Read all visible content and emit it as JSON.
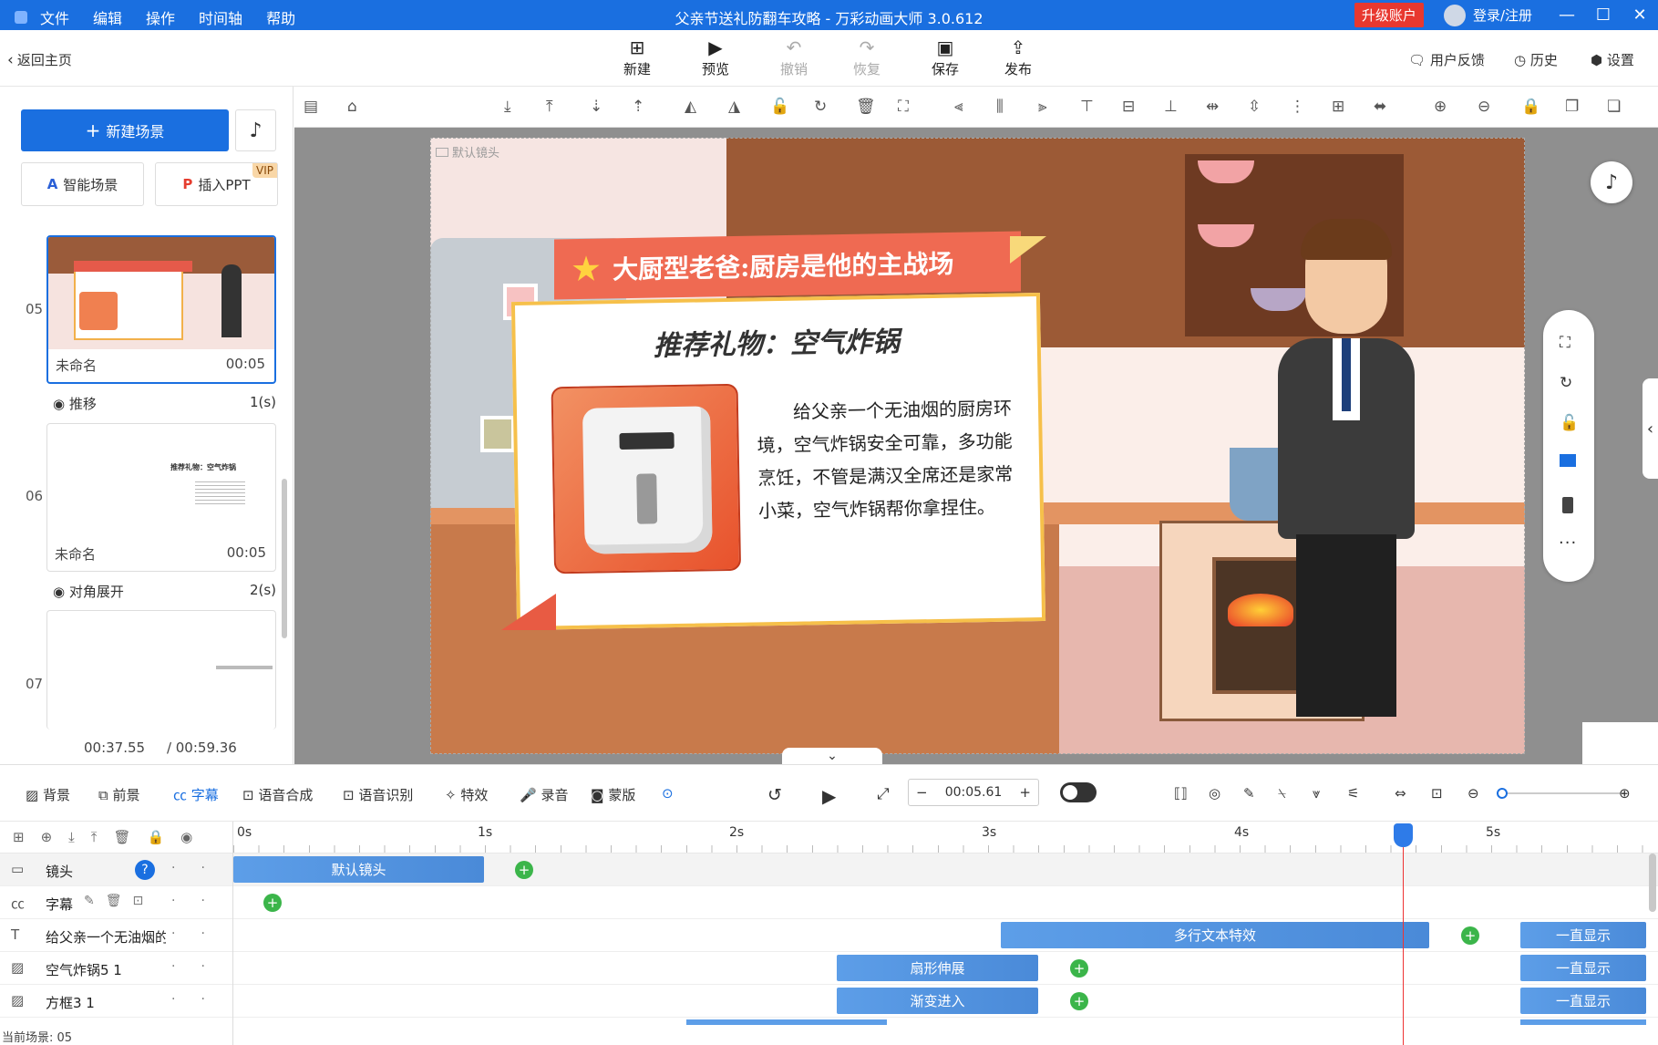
{
  "titlebar": {
    "menus": [
      "文件",
      "编辑",
      "操作",
      "时间轴",
      "帮助"
    ],
    "title": "父亲节送礼防翻车攻略 - 万彩动画大师 3.0.612",
    "upgrade": "升级账户",
    "login": "登录/注册"
  },
  "toolbar": {
    "back": "返回主页",
    "new": "新建",
    "preview": "预览",
    "undo": "撤销",
    "redo": "恢复",
    "save": "保存",
    "publish": "发布",
    "feedback": "用户反馈",
    "history": "历史",
    "settings": "设置"
  },
  "leftpanel": {
    "new_scene": "新建场景",
    "smart_scene": "智能场景",
    "insert_ppt": "插入PPT",
    "vip": "VIP",
    "scenes": [
      {
        "num": "05",
        "name": "未命名",
        "duration": "00:05"
      },
      {
        "num": "06",
        "name": "未命名",
        "duration": "00:05"
      },
      {
        "num": "07"
      }
    ],
    "transitions": [
      {
        "name": "推移",
        "duration": "1(s)"
      },
      {
        "name": "对角展开",
        "duration": "2(s)"
      }
    ],
    "time_current": "00:37.55",
    "time_total": "/ 00:59.36",
    "thumb_title": "推荐礼物：空气炸锅"
  },
  "stage": {
    "camera_label": "默认镜头",
    "banner": "大厨型老爸:厨房是他的主战场",
    "card_title": "推荐礼物：空气炸锅",
    "card_text": "给父亲一个无油烟的厨房环境，空气炸锅安全可靠，多功能烹饪，不管是满汉全席还是家常小菜，空气炸锅帮你拿捏住。"
  },
  "timeline": {
    "tools": [
      "背景",
      "前景",
      "字幕",
      "语音合成",
      "语音识别",
      "特效",
      "录音",
      "蒙版"
    ],
    "time": "00:05.61",
    "ruler": [
      "0s",
      "1s",
      "2s",
      "3s",
      "4s",
      "5s"
    ],
    "tracks": [
      {
        "name": "镜头",
        "clips": [
          "默认镜头"
        ]
      },
      {
        "name": "字幕"
      },
      {
        "name": "给父亲一个无油烟的",
        "clips": [
          "多行文本特效",
          "一直显示"
        ]
      },
      {
        "name": "空气炸锅5 1",
        "clips": [
          "扇形伸展",
          "一直显示"
        ]
      },
      {
        "name": "方框3 1",
        "clips": [
          "渐变进入",
          "一直显示"
        ]
      }
    ],
    "current_scene": "当前场景: 05"
  }
}
